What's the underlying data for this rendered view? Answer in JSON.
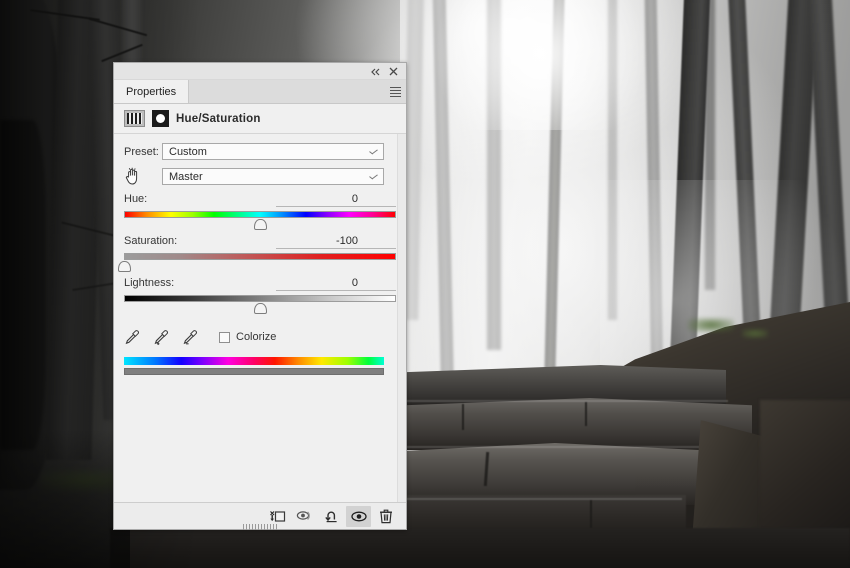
{
  "window": {
    "collapse_icon": "double-chevron-left-icon",
    "close_icon": "close-icon",
    "menu_icon": "panel-menu-icon"
  },
  "tabs": [
    {
      "label": "Properties",
      "active": true
    }
  ],
  "adjustment": {
    "layer_thumb_icon": "adjustment-layer-thumbnail",
    "mask_thumb_icon": "layer-mask-thumbnail",
    "title": "Hue/Saturation"
  },
  "preset": {
    "label": "Preset:",
    "value": "Custom",
    "chevron_icon": "chevron-down-icon"
  },
  "channel": {
    "hand_icon": "on-image-adjustment-hand-icon",
    "value": "Master",
    "chevron_icon": "chevron-down-icon"
  },
  "sliders": [
    {
      "name": "Hue:",
      "value": "0",
      "thumb_pct": 50,
      "kind": "hue"
    },
    {
      "name": "Saturation:",
      "value": "-100",
      "thumb_pct": 0,
      "kind": "sat"
    },
    {
      "name": "Lightness:",
      "value": "0",
      "thumb_pct": 50,
      "kind": "light"
    }
  ],
  "tools": {
    "eyedropper_icon": "eyedropper-icon",
    "eyedropper_add_icon": "eyedropper-add-icon",
    "eyedropper_subtract_icon": "eyedropper-subtract-icon",
    "colorize_label": "Colorize",
    "colorize_checked": false
  },
  "footer": {
    "buttons": [
      {
        "icon": "clip-to-layer-icon",
        "active": false
      },
      {
        "icon": "view-previous-state-icon",
        "active": false
      },
      {
        "icon": "reset-icon",
        "active": false
      },
      {
        "icon": "toggle-layer-visibility-icon",
        "active": true
      },
      {
        "icon": "delete-layer-icon",
        "active": false
      }
    ],
    "resize_grip_icon": "resize-grip-icon"
  },
  "colors": {
    "panel_bg": "#f0f0f0",
    "tab_bg": "#dcdcdc",
    "footer_bg": "#ececec",
    "border": "#a9a9a9",
    "text": "#2b2b2b",
    "active_btn_bg": "#d2d2d2"
  }
}
